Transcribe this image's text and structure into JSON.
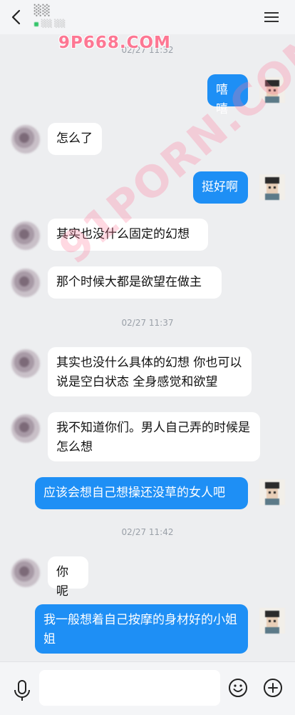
{
  "header": {
    "contact_name": "░░",
    "contact_status": "░░ ░░"
  },
  "watermark": {
    "top": "9P668.COM",
    "diagonal": "91PORN.COM"
  },
  "messages": [
    {
      "type": "time",
      "text": "02/27 11:32"
    },
    {
      "type": "msg",
      "from": "me",
      "text": "嘻嘻"
    },
    {
      "type": "msg",
      "from": "them",
      "text": "怎么了"
    },
    {
      "type": "msg",
      "from": "me",
      "text": "挺好啊"
    },
    {
      "type": "msg",
      "from": "them",
      "text": "其实也没什么固定的幻想"
    },
    {
      "type": "msg",
      "from": "them",
      "text": "那个时候大都是欲望在做主"
    },
    {
      "type": "time",
      "text": "02/27 11:37"
    },
    {
      "type": "msg",
      "from": "them",
      "text": "其实也没什么具体的幻想 你也可以说是空白状态 全身感觉和欲望"
    },
    {
      "type": "msg",
      "from": "them",
      "text": "我不知道你们。男人自己弄的时候是怎么想"
    },
    {
      "type": "msg",
      "from": "me",
      "text": "应该会想自己想操还没草的女人吧"
    },
    {
      "type": "time",
      "text": "02/27 11:42"
    },
    {
      "type": "msg",
      "from": "them",
      "text": "你呢"
    },
    {
      "type": "msg",
      "from": "me",
      "text": "我一般想着自己按摩的身材好的小姐姐"
    }
  ],
  "input": {
    "placeholder": ""
  },
  "icons": {
    "back": "chevron-left-icon",
    "menu": "menu-icon",
    "mic": "microphone-icon",
    "emoji": "emoji-icon",
    "add": "plus-icon"
  },
  "colors": {
    "accent": "#1e8ff5",
    "background": "#edeef0",
    "bubble_them": "#ffffff",
    "watermark": "#ff6b8a"
  }
}
